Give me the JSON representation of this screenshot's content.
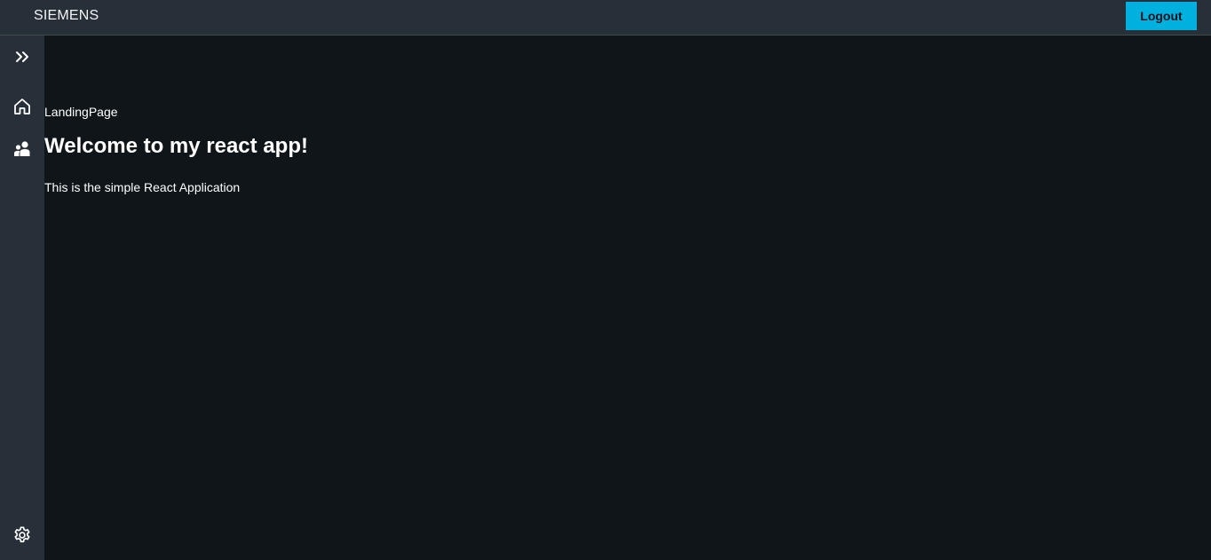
{
  "header": {
    "brand": "SIEMENS",
    "logout_label": "Logout",
    "accent_color": "#00b1e0"
  },
  "sidebar": {
    "items": [
      {
        "icon": "double-chevron-right-icon",
        "purpose": "expand"
      },
      {
        "icon": "home-icon"
      },
      {
        "icon": "users-icon"
      },
      {
        "icon": "gear-icon"
      }
    ]
  },
  "main": {
    "label": "LandingPage",
    "heading": "Welcome to my react app!",
    "description": "This is the simple React Application"
  }
}
